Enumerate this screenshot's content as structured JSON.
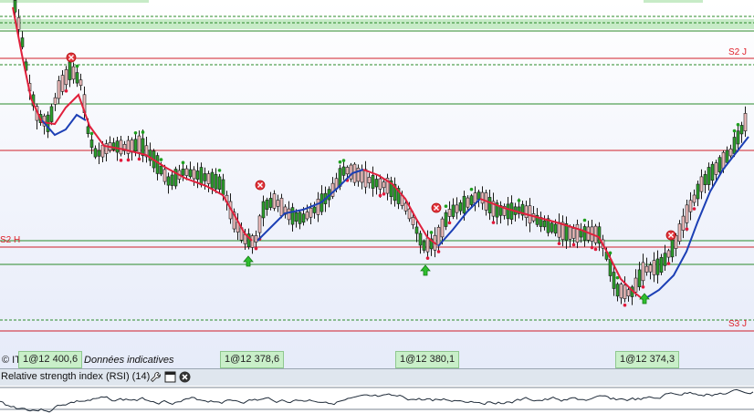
{
  "chart_data": {
    "type": "candlestick",
    "level_labels": [
      "S2 J",
      "S2 H",
      "S3 J"
    ],
    "price_tags": [
      "1@12 400,6",
      "1@12 378,6",
      "1@12 380,1",
      "1@12 374,3"
    ],
    "series": [
      {
        "name": "moving average",
        "color": "#e0203c"
      },
      {
        "name": "moving average",
        "color": "#1c3fb5"
      }
    ]
  },
  "footer": {
    "source_prefix": "© IT-Finance.com",
    "source_note": "Données indicatives"
  },
  "rsi_panel": {
    "title": "Relative strength index (RSI) (14)",
    "settings_icon": "wrench-icon",
    "maximize_icon": "window-icon",
    "close_icon": "close-icon"
  },
  "colors": {
    "bull": "#2ca02c",
    "bear": "#f2c0c0",
    "support": "#d0202a",
    "resistance": "#2a8a2a"
  }
}
